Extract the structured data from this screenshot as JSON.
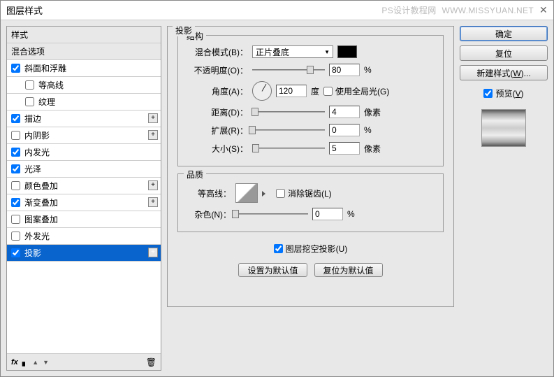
{
  "window": {
    "title": "图层样式"
  },
  "watermark": {
    "site": "PS设计教程网",
    "url": "WWW.MISSYUAN.NET"
  },
  "sidebar": {
    "header": "样式",
    "blend": "混合选项",
    "items": [
      {
        "label": "斜面和浮雕",
        "checked": true,
        "plus": false,
        "child": false
      },
      {
        "label": "等高线",
        "checked": false,
        "plus": false,
        "child": true
      },
      {
        "label": "纹理",
        "checked": false,
        "plus": false,
        "child": true
      },
      {
        "label": "描边",
        "checked": true,
        "plus": true,
        "child": false
      },
      {
        "label": "内阴影",
        "checked": false,
        "plus": true,
        "child": false
      },
      {
        "label": "内发光",
        "checked": true,
        "plus": false,
        "child": false
      },
      {
        "label": "光泽",
        "checked": true,
        "plus": false,
        "child": false
      },
      {
        "label": "颜色叠加",
        "checked": false,
        "plus": true,
        "child": false
      },
      {
        "label": "渐变叠加",
        "checked": true,
        "plus": true,
        "child": false
      },
      {
        "label": "图案叠加",
        "checked": false,
        "plus": false,
        "child": false
      },
      {
        "label": "外发光",
        "checked": false,
        "plus": false,
        "child": false
      },
      {
        "label": "投影",
        "checked": true,
        "plus": true,
        "child": false,
        "selected": true
      }
    ],
    "fx": "fx"
  },
  "panel": {
    "title": "投影",
    "structure": {
      "legend": "结构",
      "blend_label": "混合模式(B)：",
      "blend_value": "正片叠底",
      "opacity_label": "不透明度(O)：",
      "opacity_value": "80",
      "opacity_unit": "%",
      "angle_label": "角度(A)：",
      "angle_value": "120",
      "angle_unit": "度",
      "global_light": "使用全局光(G)",
      "distance_label": "距离(D)：",
      "distance_value": "4",
      "px": "像素",
      "spread_label": "扩展(R)：",
      "spread_value": "0",
      "pct": "%",
      "size_label": "大小(S)：",
      "size_value": "5"
    },
    "quality": {
      "legend": "品质",
      "contour_label": "等高线：",
      "antialias": "消除锯齿(L)",
      "noise_label": "杂色(N)：",
      "noise_value": "0",
      "pct": "%"
    },
    "knockout": "图层挖空投影(U)",
    "make_default": "设置为默认值",
    "reset_default": "复位为默认值"
  },
  "buttons": {
    "ok": "确定",
    "cancel": "复位",
    "new_style": "新建样式(W)...",
    "preview": "预览(V)"
  }
}
